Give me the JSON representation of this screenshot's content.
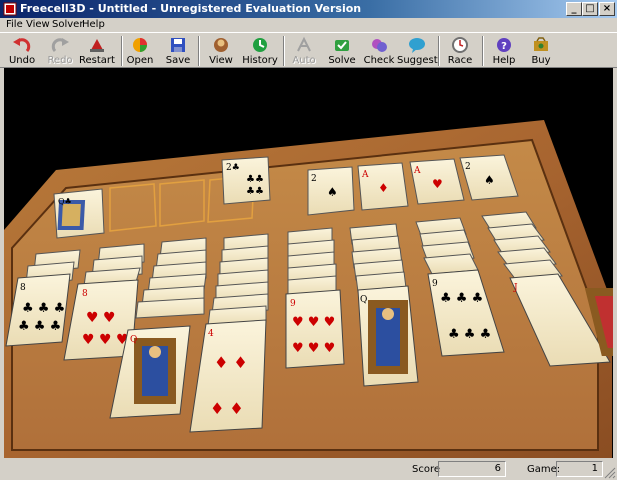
{
  "window": {
    "title": "Freecell3D - Untitled - Unregistered Evaluation Version",
    "minimize_glyph": "_",
    "maximize_glyph": "□",
    "close_glyph": "×"
  },
  "menu": [
    "File",
    "View",
    "Solver",
    "Help"
  ],
  "toolbar": [
    {
      "label": "Undo",
      "icon": "undo-arrow-icon",
      "enabled": true
    },
    {
      "label": "Redo",
      "icon": "redo-arrow-icon",
      "enabled": false
    },
    {
      "label": "Restart",
      "icon": "restart-icon",
      "enabled": true
    },
    {
      "label": "Open",
      "icon": "open-icon",
      "enabled": true
    },
    {
      "label": "Save",
      "icon": "save-disk-icon",
      "enabled": true
    },
    {
      "label": "View",
      "icon": "view-icon",
      "enabled": true
    },
    {
      "label": "History",
      "icon": "history-icon",
      "enabled": true
    },
    {
      "label": "Auto",
      "icon": "auto-icon",
      "enabled": false
    },
    {
      "label": "Solve",
      "icon": "solve-icon",
      "enabled": true
    },
    {
      "label": "Check",
      "icon": "check-icon",
      "enabled": true
    },
    {
      "label": "Suggest",
      "icon": "suggest-icon",
      "enabled": true
    },
    {
      "label": "Race",
      "icon": "race-clock-icon",
      "enabled": true
    },
    {
      "label": "Help",
      "icon": "help-icon",
      "enabled": true
    },
    {
      "label": "Buy",
      "icon": "buy-icon",
      "enabled": true
    }
  ],
  "game": {
    "free_cells": [
      "Q♣",
      "",
      "",
      "",
      "2♣"
    ],
    "foundations": [
      {
        "rank": "2",
        "suit": "♠",
        "color": "#000000"
      },
      {
        "rank": "A",
        "suit": "♦",
        "color": "#cc0000"
      },
      {
        "rank": "A",
        "suit": "♥",
        "color": "#cc0000"
      },
      {
        "rank": "2",
        "suit": "♠",
        "color": "#000000"
      }
    ],
    "columns": [
      {
        "top_rank": "8",
        "top_suit": "♣"
      },
      {
        "top_rank": "8",
        "top_suit": "♥"
      },
      {
        "top_rank": "Q",
        "top_suit": "♥"
      },
      {
        "top_rank": "4",
        "top_suit": "♦"
      },
      {
        "top_rank": "9",
        "top_suit": "♥"
      },
      {
        "top_rank": "Q",
        "top_suit": "♠"
      },
      {
        "top_rank": "9",
        "top_suit": "♣"
      },
      {
        "top_rank": "J",
        "top_suit": "♥"
      }
    ]
  },
  "status": {
    "score_label": "Score",
    "score_value": "6",
    "game_label": "Game:",
    "game_value": "1"
  },
  "colors": {
    "titlebar_start": "#0a246a",
    "titlebar_end": "#a6caf0",
    "table_wood": "#a8642a",
    "table_felt": "#c48642",
    "card_face": "#f4ecd0",
    "free_cell_outline": "#e2a040"
  }
}
